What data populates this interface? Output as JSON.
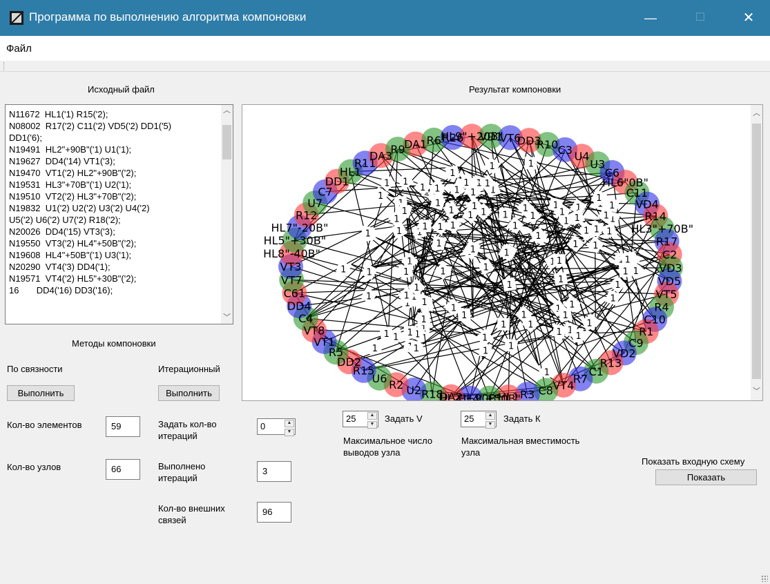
{
  "window": {
    "title": "Программа по выполнению алгоритма компоновки",
    "minimize_glyph": "—",
    "maximize_glyph": "☐",
    "close_glyph": "✕"
  },
  "menu": {
    "file": "Файл"
  },
  "source": {
    "heading": "Исходный файл",
    "lines": [
      "N11672  HL1('1) R15('2);",
      "N08002  R17('2) C11('2) VD5('2) DD1('5)",
      "DD1('6);",
      "N19491  HL2\"+90B\"('1) U1('1);",
      "N19627  DD4('14) VT1('3);",
      "N19470  VT1('2) HL2\"+90B\"('2);",
      "N19531  HL3\"+70B\"('1) U2('1);",
      "N19510  VT2('2) HL3\"+70B\"('2);",
      "N19832  U1('2) U2('2) U3('2) U4('2)",
      "U5('2) U6('2) U7('2) R18('2);",
      "N20026  DD4('15) VT3('3);",
      "N19550  VT3('2) HL4\"+50B\"('2);",
      "N19608  HL4\"+50B\"('1) U3('1);",
      "N20290  VT4('3) DD4('1);",
      "N19571  VT4('2) HL5\"+30B\"('2);",
      "16       DD4('16) DD3('16);"
    ]
  },
  "methods": {
    "heading": "Методы компоновки",
    "connectivity_label": "По связности",
    "iterative_label": "Итерационный",
    "run_connectivity": "Выполнить",
    "run_iterative": "Выполнить"
  },
  "stats": {
    "elements_label": "Кол-во элементов",
    "elements_value": "59",
    "nodes_label": "Кол-во узлов",
    "nodes_value": "66",
    "set_iterations_label_1": "Задать кол-во",
    "set_iterations_label_2": "итераций",
    "set_iterations_value": "0",
    "done_iterations_label_1": "Выполнено",
    "done_iterations_label_2": "итераций",
    "done_iterations_value": "3",
    "external_links_label_1": "Кол-во внешних",
    "external_links_label_2": "связей",
    "external_links_value": "96"
  },
  "result": {
    "heading": "Результат компоновки",
    "set_v_value": "25",
    "set_v_label": "Задать V",
    "set_k_value": "25",
    "set_k_label": "Задать К",
    "max_pins_1": "Максимальное число",
    "max_pins_2": "выводов узла",
    "max_capacity_1": "Максимальная вместимость",
    "max_capacity_2": "узла",
    "show_input_label": "Показать входную схему",
    "show_button": "Показать"
  },
  "graph": {
    "colors": {
      "red": "#ff3b3b",
      "green": "#2e9a2e",
      "blue": "#2f2fe6"
    },
    "edge_label": "1",
    "outer_labels": [
      "DA1",
      "R6",
      "R26",
      "HL9\"+20B\"",
      "VD1",
      "VT6",
      "DD3",
      "R10",
      "C3",
      "U4",
      "U3",
      "C6",
      "HL6\"0B\"",
      "C11",
      "VD4",
      "R14",
      "HL3\"+70B\"",
      "R17",
      "C2",
      "VD3",
      "VD5",
      "VT5",
      "R4",
      "C10",
      "R1",
      "C9",
      "VD2",
      "R13",
      "C1",
      "R7",
      "VT4",
      "C8",
      "R3",
      "HL1",
      "HL4\"+50B\"",
      "HL2\"+90B\"",
      "DA2",
      "R18",
      "U2",
      "R2",
      "U6",
      "R15",
      "DD2",
      "R5",
      "VT1",
      "VT8",
      "C4",
      "DD4",
      "C61",
      "VT7",
      "VT3",
      "HL8\"-40B\"",
      "HL5\"+30B\"",
      "HL7\"-20B\"",
      "R12",
      "U7",
      "C7",
      "DD1",
      "HL1",
      "R11",
      "DA3",
      "R9"
    ]
  }
}
